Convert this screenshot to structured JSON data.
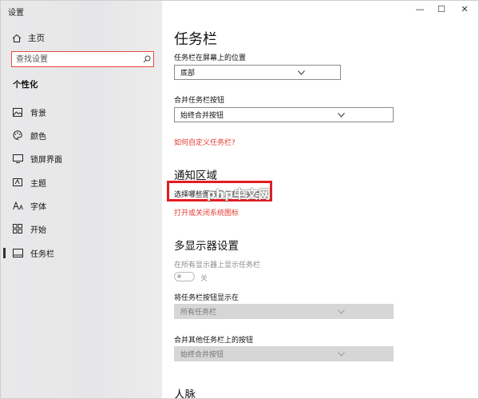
{
  "window": {
    "title": "设置",
    "minimize": "—",
    "maximize": "☐",
    "close": "✕"
  },
  "sidebar": {
    "home_label": "主页",
    "search_placeholder": "查找设置",
    "section_title": "个性化",
    "items": [
      {
        "label": "背景",
        "icon": "image-icon"
      },
      {
        "label": "颜色",
        "icon": "palette-icon"
      },
      {
        "label": "锁屏界面",
        "icon": "lock-screen-icon"
      },
      {
        "label": "主题",
        "icon": "theme-icon"
      },
      {
        "label": "字体",
        "icon": "font-icon"
      },
      {
        "label": "开始",
        "icon": "start-icon"
      },
      {
        "label": "任务栏",
        "icon": "taskbar-icon",
        "active": true
      }
    ]
  },
  "main": {
    "title": "任务栏",
    "screen_position_label": "任务栏在屏幕上的位置",
    "screen_position_value": "底部",
    "combine_label": "合并任务栏按钮",
    "combine_value": "始终合并按钮",
    "customize_link": "如何自定义任务栏?",
    "notify_heading": "通知区域",
    "notify_link1": "选择哪些图标显示在任务栏上",
    "notify_link2": "打开或关闭系统图标",
    "watermark": "php中文网",
    "multi_heading": "多显示器设置",
    "multi_show_label": "在所有显示器上显示任务栏",
    "toggle_state": "关",
    "multi_buttons_label": "将任务栏按钮显示在",
    "multi_buttons_value": "所有任务栏",
    "multi_combine_label": "合并其他任务栏上的按钮",
    "multi_combine_value": "始终合并按钮",
    "people_heading": "人脉"
  },
  "colors": {
    "accent_link": "#e53a2f",
    "highlight_box": "#e31c23"
  }
}
